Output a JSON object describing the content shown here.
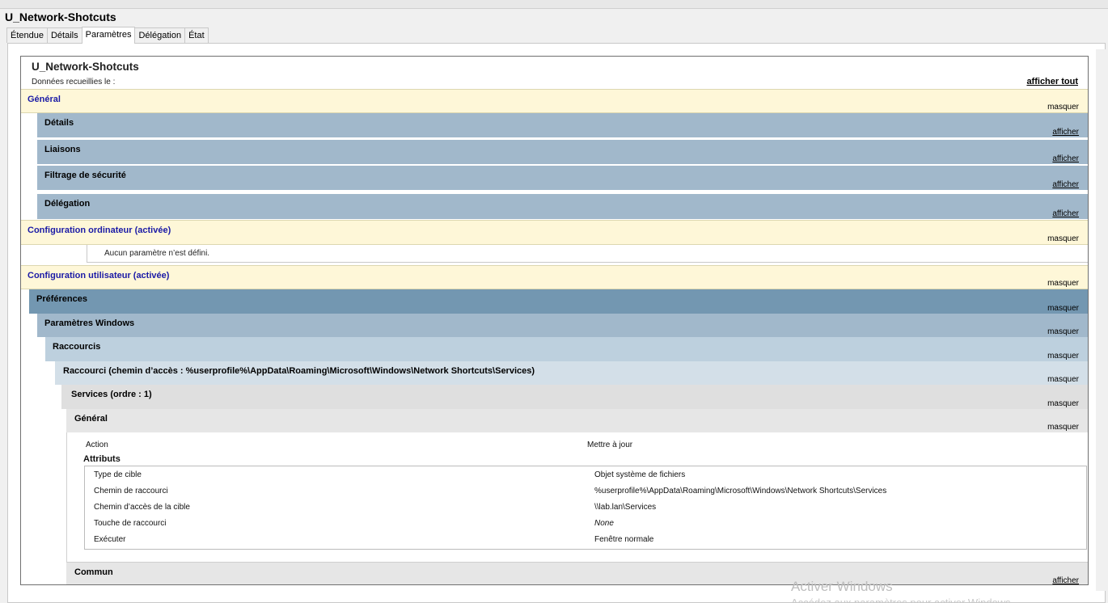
{
  "window": {
    "title": "U_Network-Shotcuts"
  },
  "tabs": [
    {
      "label": "Étendue"
    },
    {
      "label": "Détails"
    },
    {
      "label": "Paramètres",
      "active": true
    },
    {
      "label": "Délégation"
    },
    {
      "label": "État"
    }
  ],
  "report": {
    "title": "U_Network-Shotcuts",
    "subtitle": "Données recueillies le :",
    "show_all": "afficher tout"
  },
  "labels": {
    "hide": "masquer",
    "show": "afficher"
  },
  "sections": {
    "general": "Général",
    "details": "Détails",
    "links": "Liaisons",
    "security": "Filtrage de sécurité",
    "delegation": "Délégation",
    "computer_config": "Configuration ordinateur (activée)",
    "no_settings": "Aucun paramètre n’est défini.",
    "user_config": "Configuration utilisateur (activée)",
    "preferences": "Préférences",
    "windows_settings": "Paramètres Windows",
    "shortcuts": "Raccourcis",
    "shortcut_path": "Raccourci (chemin d’accès : %userprofile%\\AppData\\Roaming\\Microsoft\\Windows\\Network Shortcuts\\Services)",
    "services": "Services (ordre : 1)",
    "general2": "Général",
    "common": "Commun"
  },
  "action": {
    "label": "Action",
    "value": "Mettre à jour"
  },
  "attributes": {
    "heading": "Attributs",
    "rows": [
      {
        "label": "Type de cible",
        "value": "Objet système de fichiers"
      },
      {
        "label": "Chemin de raccourci",
        "value": "%userprofile%\\AppData\\Roaming\\Microsoft\\Windows\\Network Shortcuts\\Services"
      },
      {
        "label": "Chemin d’accès de la cible",
        "value": "\\\\lab.lan\\Services"
      },
      {
        "label": "Touche de raccourci",
        "value": "None"
      },
      {
        "label": "Exécuter",
        "value": "Fenêtre normale"
      }
    ]
  },
  "watermark": {
    "line1": "Activer Windows",
    "line2": "Accédez aux paramètres pour activer Windows."
  }
}
